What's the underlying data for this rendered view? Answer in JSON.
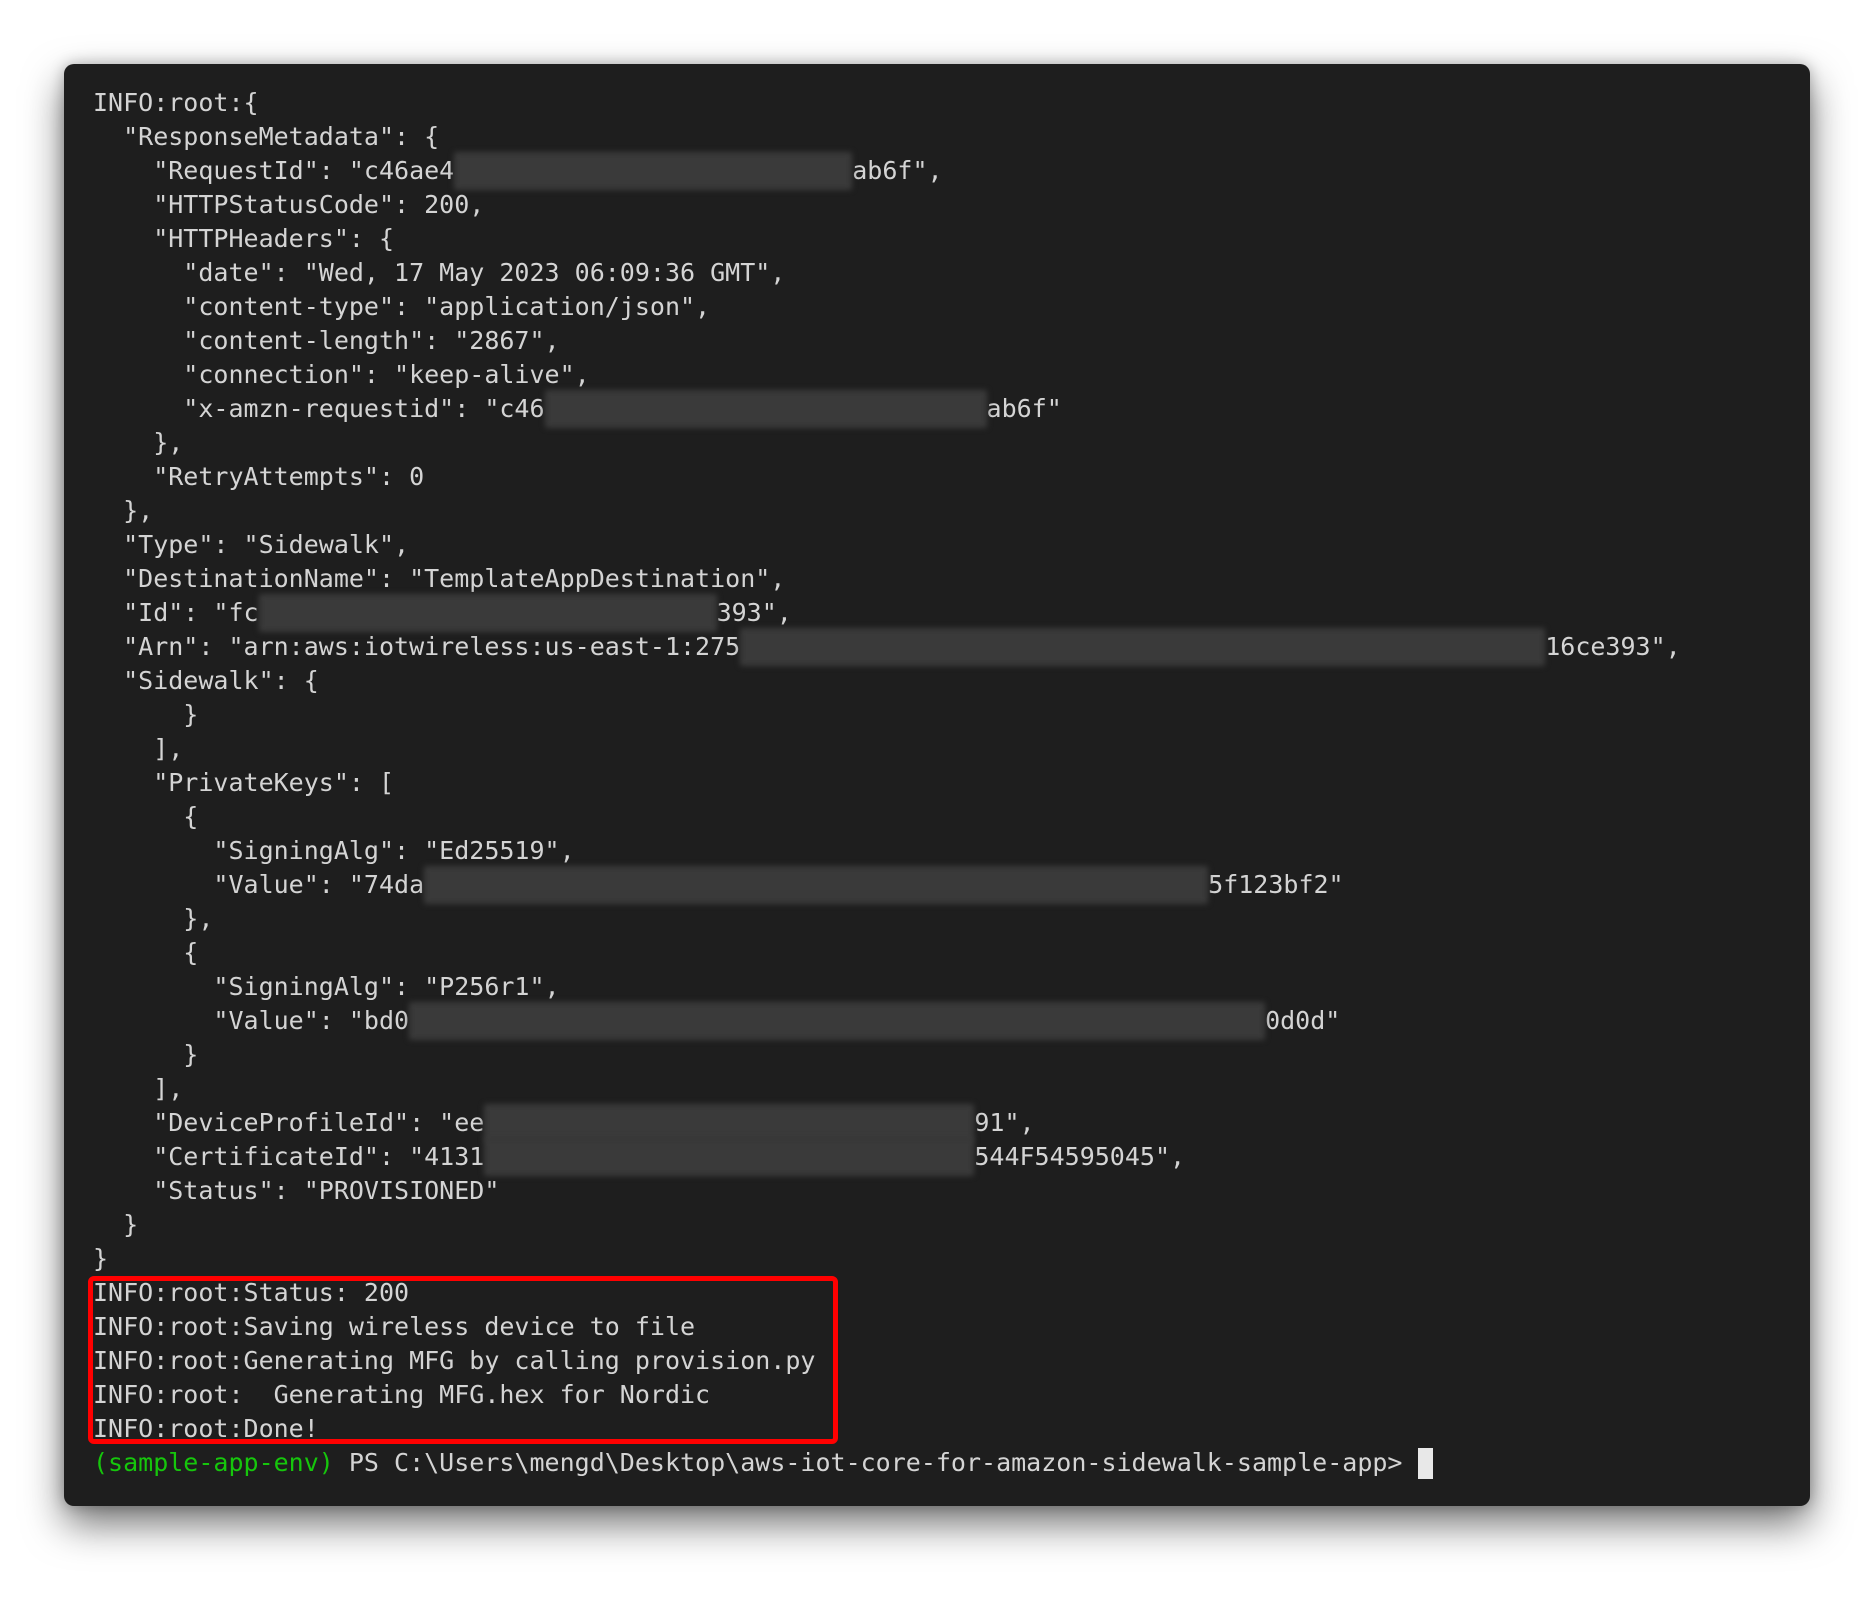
{
  "terminal": {
    "lines": [
      {
        "pre": "INFO:root:{",
        "redact_w": 0,
        "post": ""
      },
      {
        "pre": "  \"ResponseMetadata\": {",
        "redact_w": 0,
        "post": ""
      },
      {
        "pre": "    \"RequestId\": \"c46ae4",
        "redact_w": 398,
        "post": "ab6f\","
      },
      {
        "pre": "    \"HTTPStatusCode\": 200,",
        "redact_w": 0,
        "post": ""
      },
      {
        "pre": "    \"HTTPHeaders\": {",
        "redact_w": 0,
        "post": ""
      },
      {
        "pre": "      \"date\": \"Wed, 17 May 2023 06:09:36 GMT\",",
        "redact_w": 0,
        "post": ""
      },
      {
        "pre": "      \"content-type\": \"application/json\",",
        "redact_w": 0,
        "post": ""
      },
      {
        "pre": "      \"content-length\": \"2867\",",
        "redact_w": 0,
        "post": ""
      },
      {
        "pre": "      \"connection\": \"keep-alive\",",
        "redact_w": 0,
        "post": ""
      },
      {
        "pre": "      \"x-amzn-requestid\": \"c46",
        "redact_w": 442,
        "post": "ab6f\""
      },
      {
        "pre": "    },",
        "redact_w": 0,
        "post": ""
      },
      {
        "pre": "    \"RetryAttempts\": 0",
        "redact_w": 0,
        "post": ""
      },
      {
        "pre": "  },",
        "redact_w": 0,
        "post": ""
      },
      {
        "pre": "  \"Type\": \"Sidewalk\",",
        "redact_w": 0,
        "post": ""
      },
      {
        "pre": "  \"DestinationName\": \"TemplateAppDestination\",",
        "redact_w": 0,
        "post": ""
      },
      {
        "pre": "  \"Id\": \"fc",
        "redact_w": 458,
        "post": "393\","
      },
      {
        "pre": "  \"Arn\": \"arn:aws:iotwireless:us-east-1:275",
        "redact_w": 805,
        "post": "16ce393\","
      },
      {
        "pre": "  \"Sidewalk\": {",
        "redact_w": 0,
        "post": ""
      },
      {
        "pre": "      }",
        "redact_w": 0,
        "post": ""
      },
      {
        "pre": "    ],",
        "redact_w": 0,
        "post": ""
      },
      {
        "pre": "    \"PrivateKeys\": [",
        "redact_w": 0,
        "post": ""
      },
      {
        "pre": "      {",
        "redact_w": 0,
        "post": ""
      },
      {
        "pre": "        \"SigningAlg\": \"Ed25519\",",
        "redact_w": 0,
        "post": ""
      },
      {
        "pre": "        \"Value\": \"74da",
        "redact_w": 784,
        "post": "5f123bf2\""
      },
      {
        "pre": "      },",
        "redact_w": 0,
        "post": ""
      },
      {
        "pre": "      {",
        "redact_w": 0,
        "post": ""
      },
      {
        "pre": "        \"SigningAlg\": \"P256r1\",",
        "redact_w": 0,
        "post": ""
      },
      {
        "pre": "        \"Value\": \"bd0",
        "redact_w": 856,
        "post": "0d0d\""
      },
      {
        "pre": "      }",
        "redact_w": 0,
        "post": ""
      },
      {
        "pre": "    ],",
        "redact_w": 0,
        "post": ""
      },
      {
        "pre": "    \"DeviceProfileId\": \"ee",
        "redact_w": 490,
        "post": "91\","
      },
      {
        "pre": "    \"CertificateId\": \"4131",
        "redact_w": 490,
        "post": "544F54595045\","
      },
      {
        "pre": "    \"Status\": \"PROVISIONED\"",
        "redact_w": 0,
        "post": ""
      },
      {
        "pre": "  }",
        "redact_w": 0,
        "post": ""
      },
      {
        "pre": "}",
        "redact_w": 0,
        "post": ""
      },
      {
        "pre": "INFO:root:Status: 200",
        "redact_w": 0,
        "post": ""
      },
      {
        "pre": "INFO:root:Saving wireless device to file",
        "redact_w": 0,
        "post": ""
      },
      {
        "pre": "INFO:root:Generating MFG by calling provision.py",
        "redact_w": 0,
        "post": ""
      },
      {
        "pre": "INFO:root:  Generating MFG.hex for Nordic",
        "redact_w": 0,
        "post": ""
      },
      {
        "pre": "INFO:root:Done!",
        "redact_w": 0,
        "post": ""
      }
    ],
    "prompt": {
      "env": "(sample-app-env)",
      "path": " PS C:\\Users\\mengd\\Desktop\\aws-iot-core-for-amazon-sidewalk-sample-app>"
    },
    "colors": {
      "background": "#1e1e1e",
      "text": "#d4d4d4",
      "env": "#16c60c",
      "highlight": "#ff0000"
    }
  }
}
